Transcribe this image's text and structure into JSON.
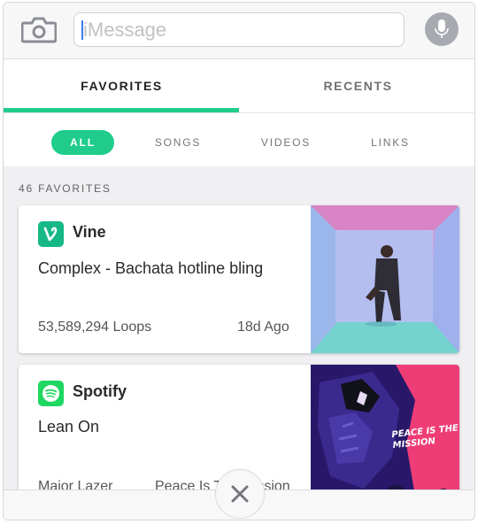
{
  "colors": {
    "accent": "#1fcc8c",
    "vine": "#15b886",
    "spotify": "#1ed760",
    "pink": "#ee3d76"
  },
  "topbar": {
    "placeholder": "iMessage",
    "camera_icon": "camera-icon",
    "mic_icon": "microphone-icon"
  },
  "tabs": [
    {
      "label": "FAVORITES",
      "active": true
    },
    {
      "label": "RECENTS",
      "active": false
    }
  ],
  "filters": [
    {
      "label": "ALL",
      "active": true
    },
    {
      "label": "SONGS",
      "active": false
    },
    {
      "label": "VIDEOS",
      "active": false
    },
    {
      "label": "LINKS",
      "active": false
    }
  ],
  "list": {
    "count_label": "46 FAVORITES",
    "items": [
      {
        "app": "Vine",
        "icon": "vine-icon",
        "title": "Complex - Bachata hotline bling",
        "stat": "53,589,294 Loops",
        "age": "18d Ago"
      },
      {
        "app": "Spotify",
        "icon": "spotify-icon",
        "title": "Lean On",
        "artist": "Major Lazer",
        "album": "Peace Is The Mission",
        "cover_text": "PEACE IS THE MISSION"
      }
    ]
  },
  "bottom": {
    "close_icon": "close-icon"
  }
}
